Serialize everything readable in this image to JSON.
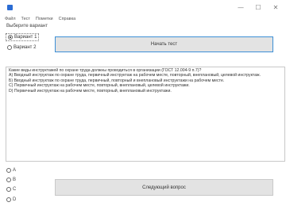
{
  "window": {
    "min_icon": "minimize-icon",
    "max_icon": "maximize-icon",
    "close_icon": "close-icon",
    "min_glyph": "—",
    "max_glyph": "☐",
    "close_glyph": "✕"
  },
  "menu": [
    "Файл",
    "Тест",
    "Пометки",
    "Справка"
  ],
  "variant_label": "Выберите вариант",
  "variants": [
    {
      "label": "Вариант 1",
      "selected": true
    },
    {
      "label": "Вариант 2",
      "selected": false
    }
  ],
  "start_button": "Начать тест",
  "question": {
    "lines": [
      "Какие виды инструктажей по охране труда должны проводиться в организации (ГОСТ 12.004-9 п.7)?",
      "А) Вводный инструктаж по охране труда, первичный инструктаж на рабочем месте, повторный, внеплановый, целевой инструктаж.",
      "Б) Вводный инструктаж по охране труда, первичный, повторный и внеплановый инструктажи на рабочем месте.",
      "С) Первичный инструктаж на рабочем месте, повторный, внеплановый, целевой инструктажи.",
      "D) Первичный инструктаж на рабочем месте, повторный, внеплановый инструктажи."
    ]
  },
  "answers": [
    "A",
    "B",
    "C",
    "D"
  ],
  "next_button": "Следующий вопрос"
}
